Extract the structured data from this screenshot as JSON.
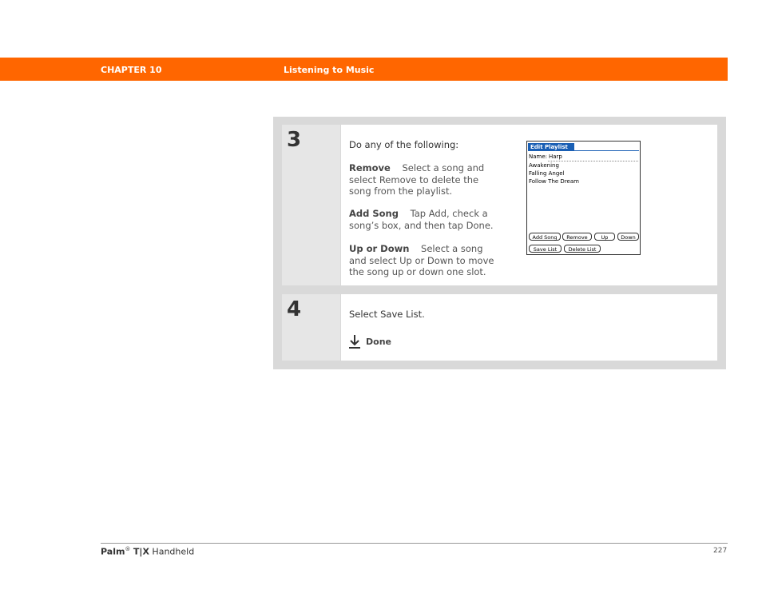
{
  "header": {
    "chapter": "CHAPTER 10",
    "title": "Listening to Music"
  },
  "steps": [
    {
      "number": "3",
      "intro": "Do any of the following:",
      "items": [
        {
          "term": "Remove",
          "desc": "Select a song and select Remove to delete the song from the playlist."
        },
        {
          "term": "Add Song",
          "desc": "Tap Add, check a song’s box, and then tap Done."
        },
        {
          "term": "Up or Down",
          "desc": "Select a song and select Up or Down to move the song up or down one slot."
        }
      ]
    },
    {
      "number": "4",
      "intro": "Select Save List.",
      "done_label": "Done"
    }
  ],
  "palm_screen": {
    "title": "Edit Playlist",
    "name_label": "Name:",
    "name_value": "Harp",
    "songs": [
      "Awakening",
      "Falling Angel",
      "Follow The Dream"
    ],
    "buttons": {
      "add_song": "Add Song",
      "remove": "Remove",
      "up": "Up",
      "down": "Down",
      "save_list": "Save List",
      "delete_list": "Delete List"
    }
  },
  "footer": {
    "brand": "Palm",
    "registered": "®",
    "model": "T|X",
    "suffix": " Handheld",
    "page": "227"
  },
  "colors": {
    "accent": "#ff6600",
    "palm_title": "#1a5fb4",
    "panel": "#d9d9d9"
  }
}
